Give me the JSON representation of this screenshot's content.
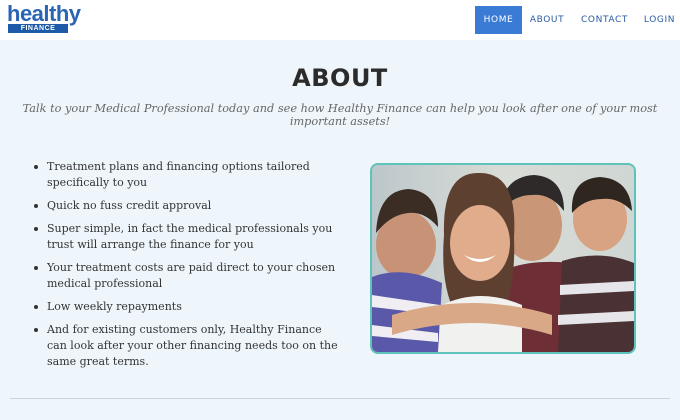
{
  "brand": {
    "name": "healthy",
    "sub": "FINANCE",
    "color": "#2a64b4"
  },
  "nav": {
    "items": [
      {
        "label": "HOME",
        "active": true
      },
      {
        "label": "ABOUT",
        "active": false
      },
      {
        "label": "CONTACT",
        "active": false
      },
      {
        "label": "LOGIN",
        "active": false
      }
    ],
    "active_color": "#3a7bd5"
  },
  "about": {
    "title": "ABOUT",
    "tagline": "Talk to your Medical Professional today and see how Healthy Finance can help you look after one of your most important assets!",
    "features": [
      "Treatment plans and financing options tailored specifically to you",
      "Quick no fuss credit approval",
      "Super simple, in fact the medical professionals you trust will arrange the finance for you",
      "Your treatment costs are paid direct to your chosen medical professional",
      "Low weekly repayments",
      "And for existing customers only, Healthy Finance can look after your other financing needs too on the same great terms."
    ],
    "photo_icon": "family-photo",
    "frame_color": "#5fc2bb"
  }
}
